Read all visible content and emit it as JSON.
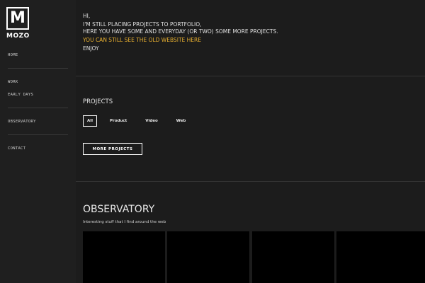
{
  "logo": {
    "mark": "M",
    "name": "MOZO"
  },
  "nav": {
    "home": "HOME",
    "work": "WORK",
    "early_days": "EARLY DAYS",
    "observatory": "OBSERVATORY",
    "contact": "CONTACT"
  },
  "intro": {
    "greeting": "HI,",
    "line1": "I'M STILL PLACING PROJECTS TO PORTFOLIO,",
    "line2": "HERE YOU HAVE SOME AND EVERYDAY (OR TWO) SOME MORE PROJECTS.",
    "link": "YOU CAN STILL SEE THE OLD WEBSITE HERE",
    "closing": "ENJOY"
  },
  "projects": {
    "title": "PROJECTS",
    "filters": [
      "All",
      "Product",
      "Video",
      "Web"
    ],
    "active_filter": "All",
    "more_button": "MORE PROJECTS"
  },
  "observatory": {
    "title": "OBSERVATORY",
    "subtitle": "Interesting stuff that I find around the web"
  },
  "colors": {
    "accent": "#e8b030",
    "background": "#1c1c1c",
    "sidebar": "#1f1f1f"
  }
}
